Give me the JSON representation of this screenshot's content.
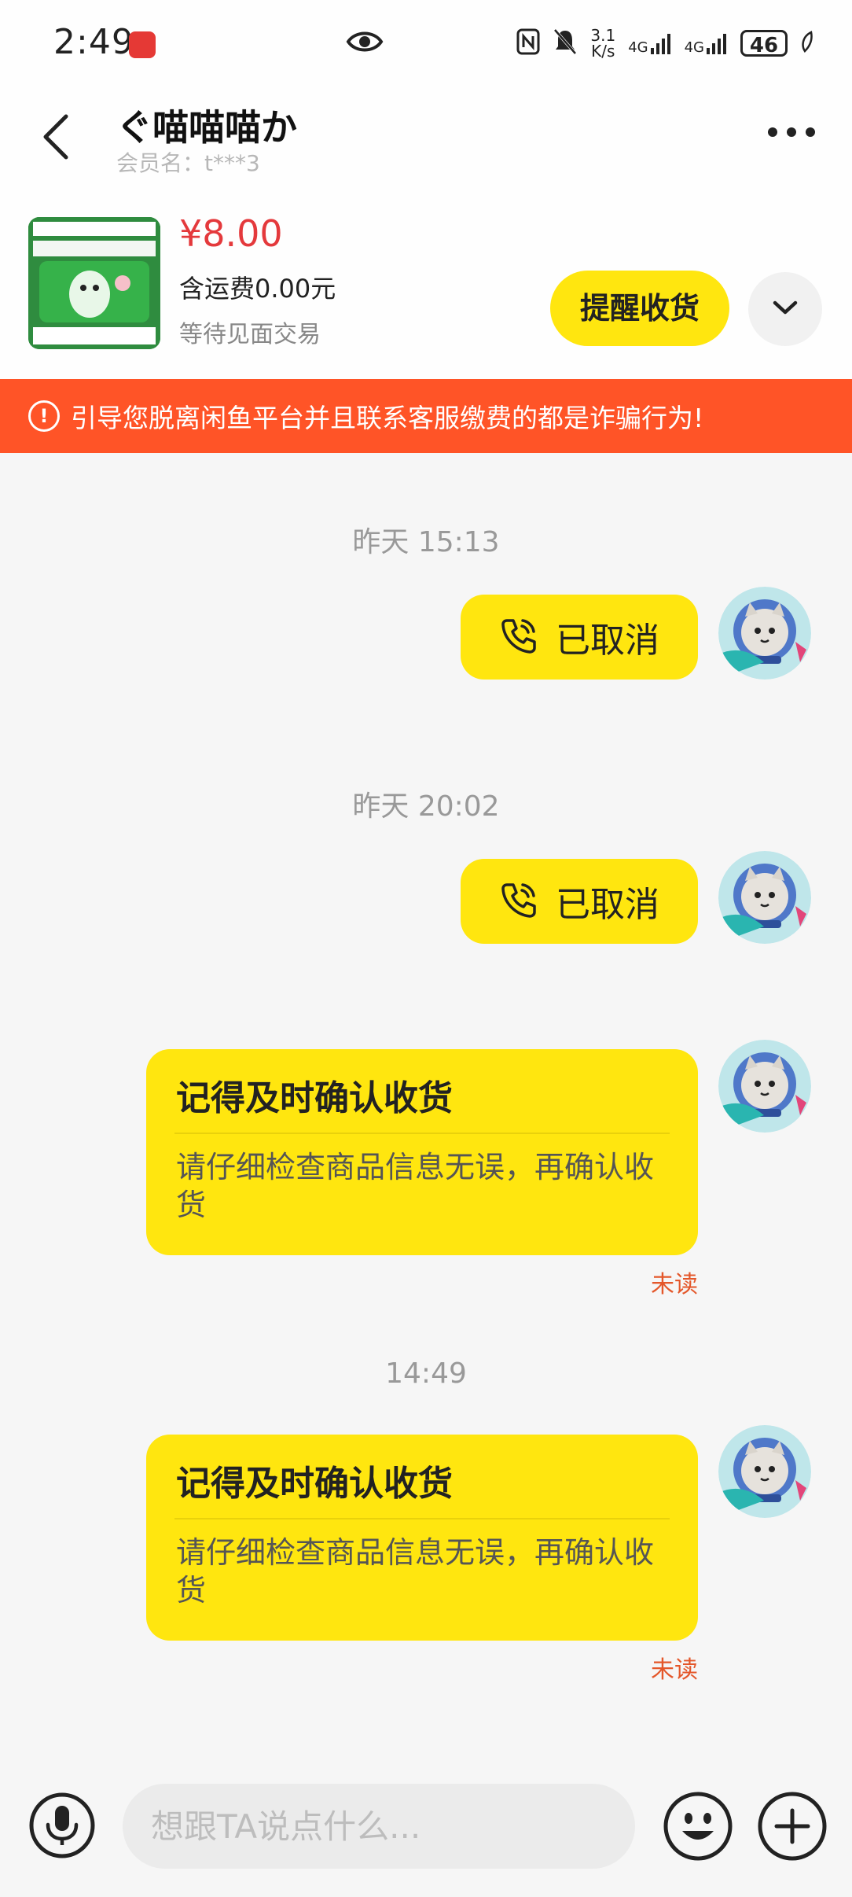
{
  "status_bar": {
    "time": "2:49",
    "net_speed_top": "3.1",
    "net_speed_bottom": "K/s",
    "net_a": "4G",
    "net_b": "4G",
    "battery": "46"
  },
  "header": {
    "title": "ぐ喵喵喵か",
    "member": "会员名：t***3"
  },
  "product": {
    "price": "¥8.00",
    "shipping": "含运费0.00元",
    "status": "等待见面交易",
    "remind_button": "提醒收货"
  },
  "warning": {
    "text": "引导您脱离闲鱼平台并且联系客服缴费的都是诈骗行为!"
  },
  "messages": [
    {
      "timestamp": "昨天 15:13",
      "call_label": "已取消"
    },
    {
      "timestamp": "昨天 20:02",
      "call_label": "已取消"
    },
    {
      "card_title": "记得及时确认收货",
      "card_body": "请仔细检查商品信息无误，再确认收货",
      "read_status": "未读"
    },
    {
      "timestamp": "14:49",
      "card_title": "记得及时确认收货",
      "card_body": "请仔细检查商品信息无误，再确认收货",
      "read_status": "未读"
    }
  ],
  "composer": {
    "placeholder": "想跟TA说点什么..."
  },
  "colors": {
    "accent_yellow": "#ffe60f",
    "warning_bar": "#ff5427",
    "price_red": "#e4393c",
    "unread_orange": "#e4572a"
  }
}
